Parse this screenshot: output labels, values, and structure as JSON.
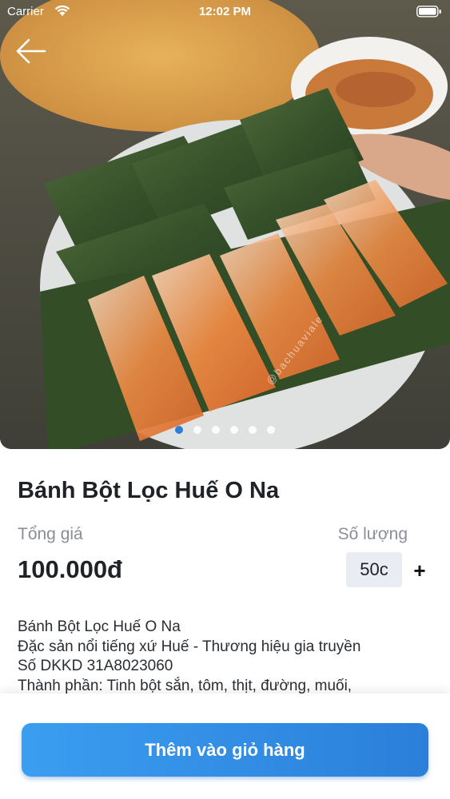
{
  "status_bar": {
    "carrier": "Carrier",
    "time": "12:02 PM"
  },
  "hero": {
    "photo_description_icon": "food-photo",
    "watermark": "@bachuaviale",
    "carousel_total": 6,
    "carousel_active": 1
  },
  "product": {
    "title": "Bánh Bột Lọc Huế O Na",
    "total_label": "Tổng giá",
    "quantity_label": "Số lượng",
    "price": "100.000đ",
    "quantity": "50c",
    "plus_label": "+"
  },
  "description": {
    "lines": [
      "Bánh Bột Lọc Huế O Na",
      "Đặc sản nổi tiếng xứ Huế - Thương hiệu gia truyền",
      "Số DKKD 31A8023060",
      "Thành phần: Tinh bột sắn, tôm, thịt, đường, muối,"
    ]
  },
  "actions": {
    "add_to_cart": "Thêm vào giỏ hàng"
  },
  "colors": {
    "accent": "#2f7fd6",
    "button_start": "#3a9ef0",
    "button_end": "#2b7fd9"
  }
}
